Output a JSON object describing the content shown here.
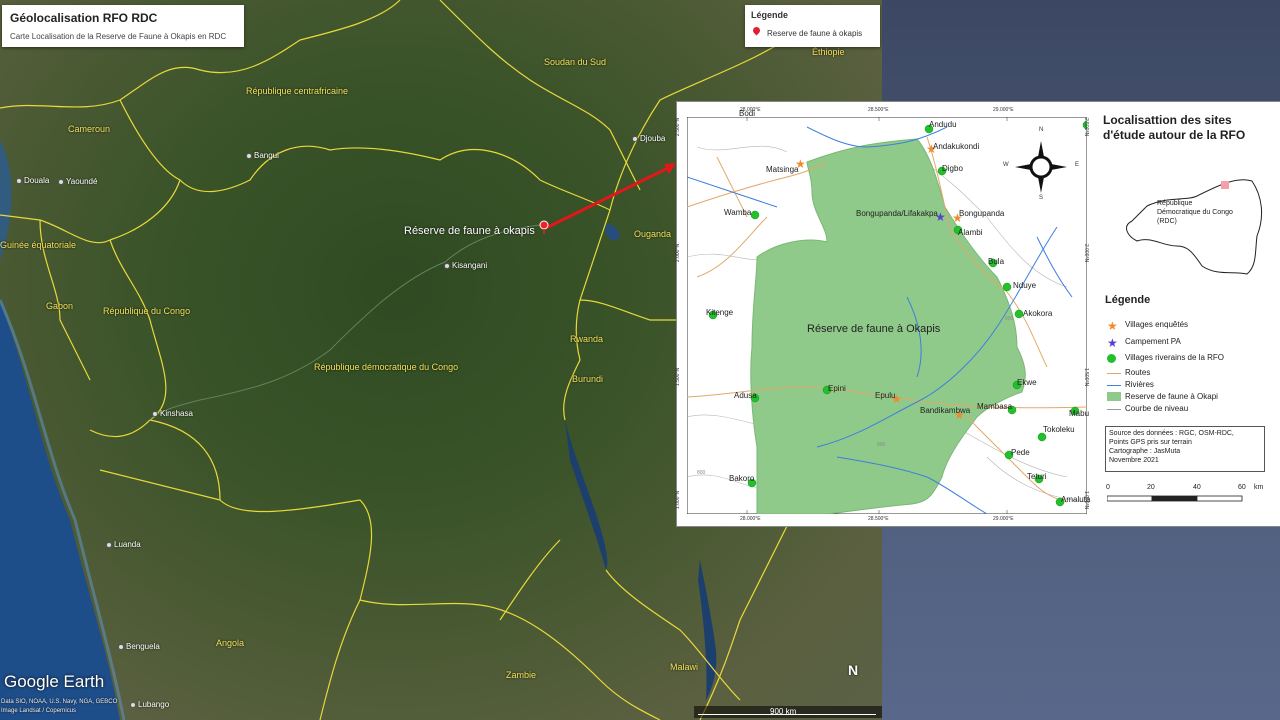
{
  "title_card": {
    "title": "Géolocalisation RFO RDC",
    "subtitle": "Carte Localisation de la Reserve de Faune à Okapis en RDC"
  },
  "legend_card": {
    "title": "Légende",
    "item": "Reserve de faune à okapis"
  },
  "map_labels": {
    "countries": [
      "Soudan du Sud",
      "Éthiopie",
      "République centrafricaine",
      "Cameroun",
      "Guinée équatoriale",
      "Gabon",
      "République du Congo",
      "République démocratique du Congo",
      "Ouganda",
      "Rwanda",
      "Burundi",
      "Angola",
      "Zambie",
      "Malawi"
    ],
    "cities": [
      "Djouba",
      "Bangui",
      "Douala",
      "Yaoundé",
      "Kisangani",
      "Kinshasa",
      "Luanda",
      "Benguela",
      "Lubango"
    ]
  },
  "reserve_marker_label": "Réserve de faune à okapis",
  "google_earth": "Google Earth",
  "credits": [
    "Data SIO, NOAA, U.S. Navy, NGA, GEBCO",
    "Image Landsat / Copernicus"
  ],
  "scale": "900 km",
  "north": "N",
  "inset": {
    "title": "Localisattion des sites d'étude autour de la RFO",
    "drc_caption": "République Démocratique du Congo (RDC)",
    "reserve_label": "Réserve de faune à Okapis",
    "graticule_top": [
      "28.000°E",
      "28.500°E",
      "29.000°E"
    ],
    "graticule_bottom": [
      "28.000°E",
      "28.500°E",
      "29.000°E"
    ],
    "graticule_left": [
      "2.500°N",
      "2.000°N",
      "1.500°N",
      "1.000°N"
    ],
    "graticule_right": [
      "2.500°N",
      "2.000°N",
      "1.500°N",
      "1.000°N"
    ],
    "contour_labels": [
      "800",
      "900",
      "900"
    ],
    "compass": {
      "n": "N",
      "s": "S",
      "e": "E",
      "w": "W"
    },
    "villages_surveyed": [
      "Matsinga",
      "Andakukondi",
      "Bongupanda",
      "Epulu",
      "Bandikambwa"
    ],
    "camp": [
      "Bongupanda/Lifakakpa"
    ],
    "villages_riverside": [
      "Andudu",
      "Digbo",
      "Alambi",
      "Wamba",
      "Bula",
      "Nduye",
      "Akokora",
      "Kitenge",
      "Epini",
      "Adusa",
      "Ekwe",
      "Mambasa",
      "Mabu",
      "Tokoleku",
      "Pede",
      "Teturi",
      "Bakoro",
      "Amaluta",
      "Bodi"
    ],
    "legend": {
      "title": "Légende",
      "items": [
        "Villages enquêtés",
        "Campement PA",
        "Villages riverains de la RFO",
        "Routes",
        "Rivières",
        "Reserve de faune à Okapi",
        "Courbe de niveau"
      ]
    },
    "source_lines": [
      "Source des données : RGC, OSM-RDC,",
      "Points GPS pris sur terrain",
      "Cartographe : JasMuta",
      "Novembre 2021"
    ],
    "scale_ticks": [
      "0",
      "20",
      "40",
      "60",
      "km"
    ],
    "colors": {
      "reserve": "#8fca8a",
      "village": "#22c02a",
      "surveyed": "#f08a2a",
      "camp": "#5a3fd0",
      "road": "#e3a86a",
      "river": "#3b7fe0",
      "contour": "#9a9a9a"
    }
  }
}
